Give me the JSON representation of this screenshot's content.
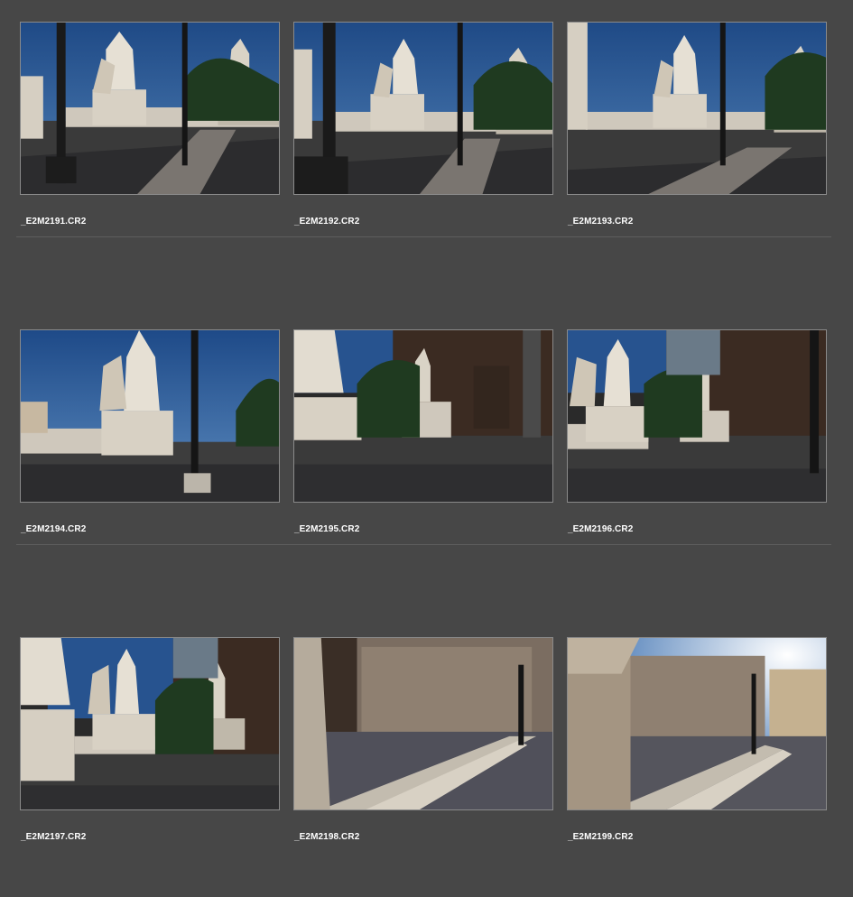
{
  "thumbnails": [
    {
      "filename": "_E2M2191.CR2",
      "scene": "statues-sky"
    },
    {
      "filename": "_E2M2192.CR2",
      "scene": "statues-sky"
    },
    {
      "filename": "_E2M2193.CR2",
      "scene": "statues-sky"
    },
    {
      "filename": "_E2M2194.CR2",
      "scene": "statue-closeup"
    },
    {
      "filename": "_E2M2195.CR2",
      "scene": "statues-building"
    },
    {
      "filename": "_E2M2196.CR2",
      "scene": "statues-building"
    },
    {
      "filename": "_E2M2197.CR2",
      "scene": "statues-building"
    },
    {
      "filename": "_E2M2198.CR2",
      "scene": "palazzo-steps"
    },
    {
      "filename": "_E2M2199.CR2",
      "scene": "palazzo-steps"
    }
  ],
  "colors": {
    "background": "#474747",
    "thumb_border": "#8a8a8a",
    "divider": "#5e5e5e",
    "label": "#ffffff"
  }
}
